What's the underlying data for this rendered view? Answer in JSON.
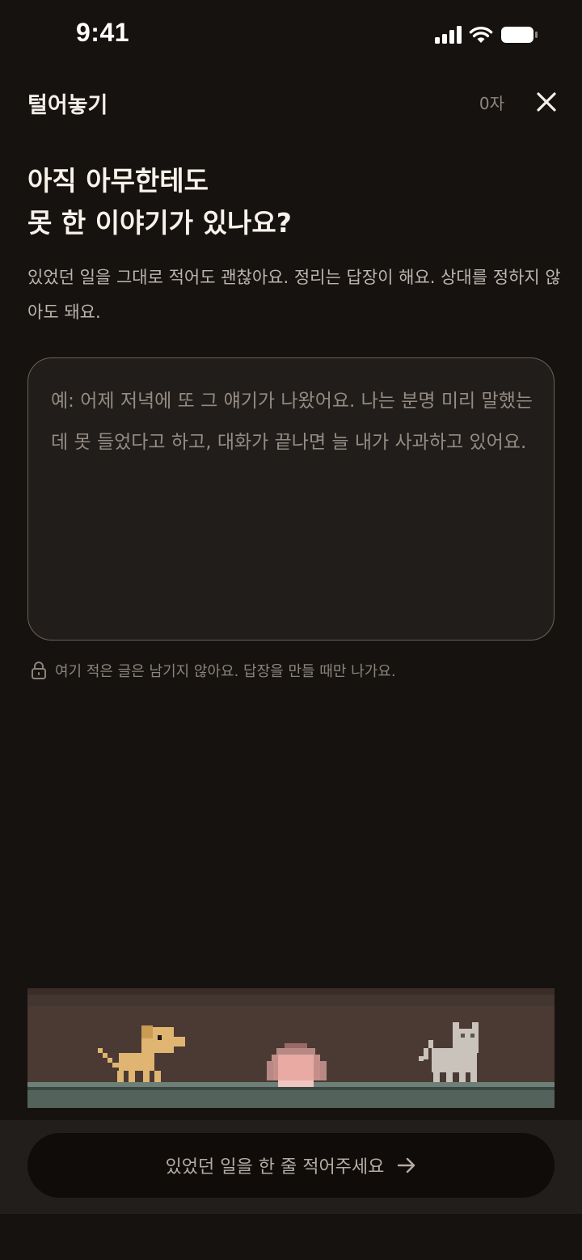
{
  "status": {
    "time": "9:41"
  },
  "header": {
    "title": "털어놓기",
    "char_count": "0자"
  },
  "headline": {
    "line1": "아직 아무한테도",
    "line2": "못 한 이야기가 있나요?"
  },
  "description": "있었던 일을 그대로 적어도 괜찮아요. 정리는 답장이 해요. 상대를 정하지 않아도 돼요.",
  "input": {
    "value": "",
    "placeholder": "예: 어제 저녁에 또 그 얘기가 나왔어요. 나는 분명 미리 말했는데 못 들었다고 하고, 대화가 끝나면 늘 내가 사과하고 있어요."
  },
  "privacy_note": "여기 적은 글은 남기지 않아요. 답장을 만들 때만 나가요.",
  "cta": {
    "label": "있었던 일을 한 줄 적어주세요"
  },
  "icons": {
    "close": "close-icon",
    "lock": "lock-icon",
    "arrow": "arrow-right-icon",
    "signal": "signal-icon",
    "wifi": "wifi-icon",
    "battery": "battery-icon"
  },
  "colors": {
    "background": "#16120f",
    "dog": "#e0b571",
    "cat": "#c9c3bb",
    "pink_blob": "#e8aaa2",
    "floor": "#53635c",
    "wall": "#4a3a33"
  }
}
